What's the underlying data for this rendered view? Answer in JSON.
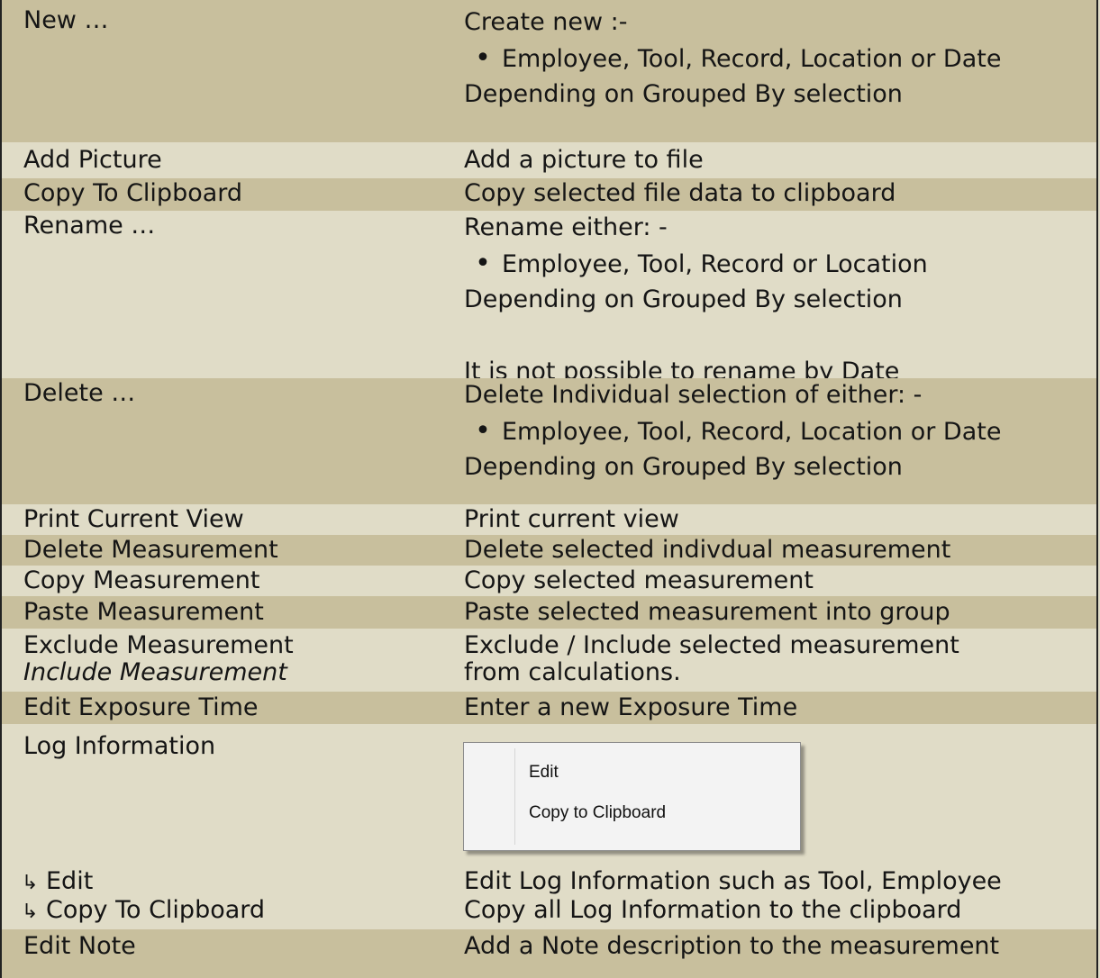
{
  "rows": [
    {
      "cmd": "New …",
      "desc": [
        "Create new :-",
        "Employee, Tool, Record, Location or Date",
        "Depending on Grouped By selection"
      ]
    },
    {
      "cmd": "Add Picture",
      "desc": [
        "Add a picture to file"
      ]
    },
    {
      "cmd": "Copy To Clipboard",
      "desc": [
        "Copy selected file data to clipboard"
      ]
    },
    {
      "cmd": "Rename …",
      "desc": [
        "Rename either: -",
        "Employee, Tool, Record or Location",
        "Depending on Grouped By selection",
        "",
        "It is not possible to rename by Date"
      ]
    },
    {
      "cmd": "Delete …",
      "desc": [
        "Delete Individual selection of either: -",
        "Employee, Tool, Record, Location or Date",
        "Depending on Grouped By selection"
      ]
    },
    {
      "cmd": "Print Current View",
      "desc": [
        "Print current view"
      ]
    },
    {
      "cmd": "Delete Measurement",
      "desc": [
        "Delete selected indivdual measurement"
      ]
    },
    {
      "cmd": "Copy Measurement",
      "desc": [
        "Copy selected measurement"
      ]
    },
    {
      "cmd": "Paste Measurement",
      "desc": [
        "Paste selected measurement into group"
      ]
    },
    {
      "cmd": "Exclude Measurement",
      "cmd2": "Include Measurement",
      "desc": [
        "Exclude / Include selected measurement",
        "from calculations."
      ]
    },
    {
      "cmd": "Edit Exposure Time",
      "desc": [
        "Enter a new Exposure Time"
      ]
    },
    {
      "cmd": "Log Information",
      "desc": []
    },
    {
      "cmd": "Edit",
      "desc": [
        "Edit Log Information such as Tool, Employee"
      ]
    },
    {
      "cmd": "Copy To Clipboard",
      "desc": [
        "Copy all Log Information to the clipboard"
      ]
    },
    {
      "cmd": "Edit Note",
      "desc": [
        "Add a Note description to the measurement"
      ]
    }
  ],
  "arrow_glyph": "↳",
  "context_menu": {
    "items": [
      "Edit",
      "Copy to Clipboard"
    ]
  }
}
